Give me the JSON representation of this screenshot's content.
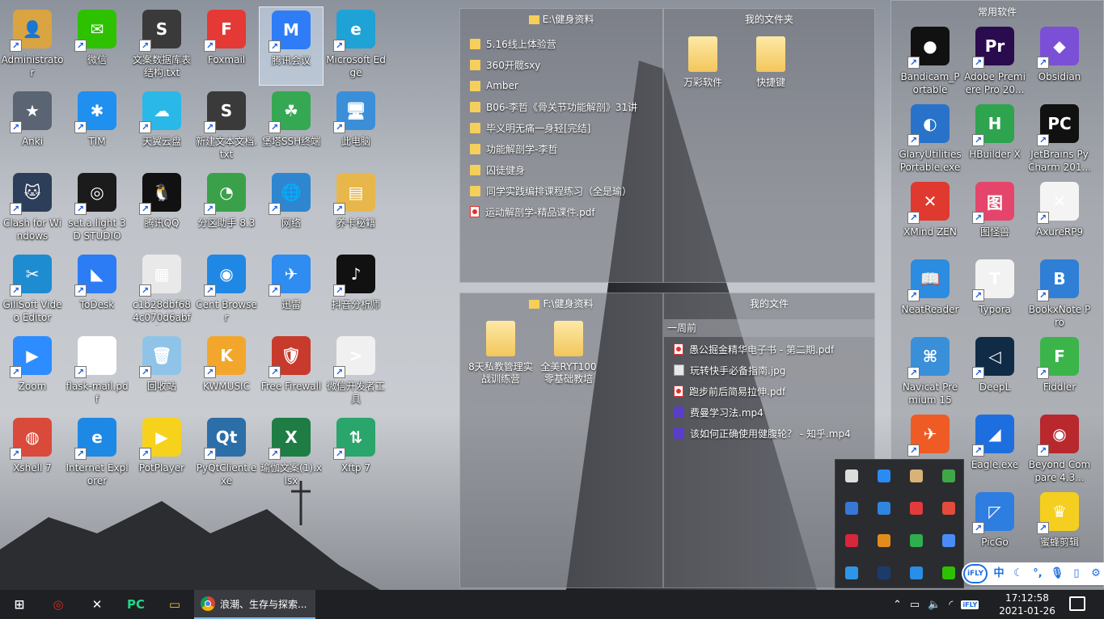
{
  "desktop_icons": [
    {
      "label": "Administrator",
      "icon": "user-folder-icon",
      "color": "#d9a441",
      "glyph": "👤"
    },
    {
      "label": "微信",
      "icon": "wechat-icon",
      "color": "#2dc100",
      "glyph": "✉"
    },
    {
      "label": "文案数据库表结构.txt",
      "icon": "sublime-text-icon",
      "color": "#3a3a3a",
      "glyph": "S"
    },
    {
      "label": "Foxmail",
      "icon": "foxmail-icon",
      "color": "#e53935",
      "glyph": "F"
    },
    {
      "label": "腾讯会议",
      "icon": "tencent-meeting-icon",
      "color": "#2f7df6",
      "glyph": "M"
    },
    {
      "label": "Microsoft Edge",
      "icon": "edge-icon",
      "color": "#1fa2d6",
      "glyph": "e"
    },
    {
      "label": "Anki",
      "icon": "anki-icon",
      "color": "#5b6473",
      "glyph": "★"
    },
    {
      "label": "TIM",
      "icon": "tim-icon",
      "color": "#1f8ff0",
      "glyph": "✱"
    },
    {
      "label": "天翼云盘",
      "icon": "cloud-disk-icon",
      "color": "#29b8e8",
      "glyph": "☁"
    },
    {
      "label": "新建文本文档.txt",
      "icon": "sublime-text-icon",
      "color": "#3a3a3a",
      "glyph": "S"
    },
    {
      "label": "堡塔SSH终端",
      "icon": "baota-ssh-icon",
      "color": "#35a853",
      "glyph": "☘"
    },
    {
      "label": "此电脑",
      "icon": "this-pc-icon",
      "color": "#3b8fd9",
      "glyph": "🖥"
    },
    {
      "label": "Clash for Windows",
      "icon": "clash-icon",
      "color": "#2d3e5a",
      "glyph": "🐱"
    },
    {
      "label": "set.a.light 3D STUDIO",
      "icon": "set-a-light-icon",
      "color": "#1b1b1b",
      "glyph": "◎"
    },
    {
      "label": "腾讯QQ",
      "icon": "qq-icon",
      "color": "#111111",
      "glyph": "🐧"
    },
    {
      "label": "分区助手 8.3",
      "icon": "partition-assistant-icon",
      "color": "#3aa14a",
      "glyph": "◔"
    },
    {
      "label": "网络",
      "icon": "network-icon",
      "color": "#2e86d1",
      "glyph": "🌐"
    },
    {
      "label": "养卡秘籍",
      "icon": "pdf-folder-icon",
      "color": "#e7b74c",
      "glyph": "▤"
    },
    {
      "label": "GiliSoft Video Editor",
      "icon": "video-editor-icon",
      "color": "#1e8cd0",
      "glyph": "✂"
    },
    {
      "label": "ToDesk",
      "icon": "todesk-icon",
      "color": "#2c7cf6",
      "glyph": "◣"
    },
    {
      "label": "c1b28dbf684c070d6abf7...",
      "icon": "image-file-icon",
      "color": "#e9e9e9",
      "glyph": "▦"
    },
    {
      "label": "Cent Browser",
      "icon": "cent-browser-icon",
      "color": "#1f88e5",
      "glyph": "◉"
    },
    {
      "label": "迅雷",
      "icon": "xunlei-icon",
      "color": "#2f8cf0",
      "glyph": "✈"
    },
    {
      "label": "抖音分析师",
      "icon": "douyin-icon",
      "color": "#111111",
      "glyph": "♪"
    },
    {
      "label": "Zoom",
      "icon": "zoom-icon",
      "color": "#2d8cff",
      "glyph": "▶"
    },
    {
      "label": "flask-mail.pdf",
      "icon": "pdf-file-icon",
      "color": "#ffffff",
      "glyph": "▯"
    },
    {
      "label": "回收站",
      "icon": "recycle-bin-icon",
      "color": "#8fc4e8",
      "glyph": "🗑"
    },
    {
      "label": "KWMUSIC",
      "icon": "kuwo-music-icon",
      "color": "#f2a72c",
      "glyph": "K"
    },
    {
      "label": "Free Firewall",
      "icon": "firewall-icon",
      "color": "#c83a2b",
      "glyph": "🛡"
    },
    {
      "label": "微信开发者工具",
      "icon": "wechat-devtools-icon",
      "color": "#f0f0f0",
      "glyph": ">"
    },
    {
      "label": "Xshell 7",
      "icon": "xshell-icon",
      "color": "#d94a3a",
      "glyph": "◍"
    },
    {
      "label": "Internet Explorer",
      "icon": "ie-icon",
      "color": "#1e88e5",
      "glyph": "e"
    },
    {
      "label": "PotPlayer",
      "icon": "potplayer-icon",
      "color": "#f7d21c",
      "glyph": "▶"
    },
    {
      "label": "PyQtClient.exe",
      "icon": "pyqt-icon",
      "color": "#2b6ea8",
      "glyph": "Qt"
    },
    {
      "label": "瑜伽文案(1).xlsx",
      "icon": "excel-file-icon",
      "color": "#1e7d45",
      "glyph": "X"
    },
    {
      "label": "Xftp 7",
      "icon": "xftp-icon",
      "color": "#2aa56b",
      "glyph": "⇅"
    }
  ],
  "fences": {
    "e_drive": {
      "title": "E:\\健身资料",
      "items": [
        {
          "name": "5.16线上体验营",
          "type": "folder"
        },
        {
          "name": "360开髋sxy",
          "type": "folder"
        },
        {
          "name": "Amber",
          "type": "folder"
        },
        {
          "name": "B06-李哲《骨关节功能解剖》31讲",
          "type": "folder"
        },
        {
          "name": "毕义明无痛一身轻[完结]",
          "type": "folder"
        },
        {
          "name": "功能解剖学-李哲",
          "type": "folder"
        },
        {
          "name": "囚徒健身",
          "type": "folder"
        },
        {
          "name": "同学实践编排课程练习（全是瑜）",
          "type": "folder"
        },
        {
          "name": "运动解剖学-精品课件.pdf",
          "type": "pdf"
        }
      ]
    },
    "my_folders": {
      "title": "我的文件夹",
      "items": [
        {
          "name": "万彩软件",
          "type": "folder"
        },
        {
          "name": "快捷键",
          "type": "folder"
        }
      ]
    },
    "f_drive": {
      "title": "F:\\健身资料",
      "items": [
        {
          "name": "8天私教管理实战训练营",
          "type": "folder"
        },
        {
          "name": "全美RYT100零基础教培",
          "type": "folder"
        }
      ]
    },
    "my_files": {
      "title": "我的文件",
      "group": "一周前",
      "items": [
        {
          "name": "愚公掘金精华电子书 - 第二期.pdf",
          "type": "pdf"
        },
        {
          "name": "玩转快手必备指南.jpg",
          "type": "jpg"
        },
        {
          "name": "跑步前后简易拉伸.pdf",
          "type": "pdf"
        },
        {
          "name": "费曼学习法.mp4",
          "type": "mp4"
        },
        {
          "name": "该如何正确使用健腹轮？ - 知乎.mp4",
          "type": "mp4"
        }
      ]
    }
  },
  "common_software": {
    "title": "常用软件",
    "items": [
      {
        "label": "Bandicam_Portable",
        "icon": "bandicam-icon",
        "color": "#111111",
        "glyph": "●"
      },
      {
        "label": "Adobe Premiere Pro 20...",
        "icon": "premiere-icon",
        "color": "#2a0c4e",
        "glyph": "Pr"
      },
      {
        "label": "Obsidian",
        "icon": "obsidian-icon",
        "color": "#7b4fd6",
        "glyph": "◆"
      },
      {
        "label": "GlaryUtilitiesPortable.exe",
        "icon": "glary-icon",
        "color": "#2873c9",
        "glyph": "◐"
      },
      {
        "label": "HBuilder X",
        "icon": "hbuilder-icon",
        "color": "#2ea44f",
        "glyph": "H"
      },
      {
        "label": "JetBrains PyCharm 201...",
        "icon": "pycharm-icon",
        "color": "#111111",
        "glyph": "PC"
      },
      {
        "label": "XMind ZEN",
        "icon": "xmind-icon",
        "color": "#e0392f",
        "glyph": "✕"
      },
      {
        "label": "图怪兽",
        "icon": "tuguaishou-icon",
        "color": "#e6456b",
        "glyph": "图"
      },
      {
        "label": "AxureRP9",
        "icon": "axure-icon",
        "color": "#f4f4f4",
        "glyph": "✕"
      },
      {
        "label": "NeatReader",
        "icon": "neatreader-icon",
        "color": "#2c8ce0",
        "glyph": "📖"
      },
      {
        "label": "Typora",
        "icon": "typora-icon",
        "color": "#f2f2f2",
        "glyph": "T"
      },
      {
        "label": "BookxNote Pro",
        "icon": "bookxnote-icon",
        "color": "#2f7fd6",
        "glyph": "B"
      },
      {
        "label": "Navicat Premium 15",
        "icon": "navicat-icon",
        "color": "#3a8fd9",
        "glyph": "⌘"
      },
      {
        "label": "DeepL",
        "icon": "deepl-icon",
        "color": "#0f2b46",
        "glyph": "◁"
      },
      {
        "label": "Fiddler",
        "icon": "fiddler-icon",
        "color": "#3bb54a",
        "glyph": "F"
      },
      {
        "label": "",
        "icon": "postman-icon",
        "color": "#ef5b25",
        "glyph": "✈"
      },
      {
        "label": "Eagle.exe",
        "icon": "eagle-icon",
        "color": "#1d6fe0",
        "glyph": "◢"
      },
      {
        "label": "Beyond Compare 4.3...",
        "icon": "beyond-compare-icon",
        "color": "#b8282d",
        "glyph": "◉"
      },
      {
        "label": "",
        "icon": "blank-icon",
        "color": "#00000000",
        "glyph": ""
      },
      {
        "label": "PicGo",
        "icon": "picgo-icon",
        "color": "#2e7de0",
        "glyph": "◸"
      },
      {
        "label": "蜜蜂剪辑",
        "icon": "bee-cut-icon",
        "color": "#f5cf1f",
        "glyph": "♛"
      }
    ]
  },
  "tray_overflow": [
    {
      "icon": "usb-icon",
      "color": "#dddddd"
    },
    {
      "icon": "shield-icon",
      "color": "#2a8bf2"
    },
    {
      "icon": "cat-icon",
      "color": "#d9b27a"
    },
    {
      "icon": "green-shield-icon",
      "color": "#3ea846"
    },
    {
      "icon": "display-icon",
      "color": "#3778d6"
    },
    {
      "icon": "pencil-app-icon",
      "color": "#2e86e0"
    },
    {
      "icon": "security-ball-icon",
      "color": "#e33b3b"
    },
    {
      "icon": "chrome-like-icon",
      "color": "#e24c3b"
    },
    {
      "icon": "cherry-icon",
      "color": "#d8263a"
    },
    {
      "icon": "colorful-app-icon",
      "color": "#e28c1c"
    },
    {
      "icon": "swirl-icon",
      "color": "#2fae4f"
    },
    {
      "icon": "baidu-disk-icon",
      "color": "#4a8cf7"
    },
    {
      "icon": "weather-icon",
      "color": "#2e96e8"
    },
    {
      "icon": "terminal-icon",
      "color": "#1b3b6b"
    },
    {
      "icon": "blue-square-icon",
      "color": "#2a8de6"
    },
    {
      "icon": "wechat-tray-icon",
      "color": "#2dc100"
    }
  ],
  "ime": {
    "brand": "iFLY",
    "mode": "中",
    "items": [
      "moon-icon",
      "punctuation-icon",
      "mic-icon",
      "clipboard-icon",
      "gear-icon"
    ]
  },
  "taskbar": {
    "pinned": [
      {
        "icon": "windows-start-icon",
        "color": "#ffffff",
        "glyph": "⊞"
      },
      {
        "icon": "netease-music-icon",
        "color": "#e02424",
        "glyph": "◎"
      },
      {
        "icon": "xmind-taskbar-icon",
        "color": "#ffffff",
        "glyph": "✕"
      },
      {
        "icon": "pycharm-taskbar-icon",
        "color": "#21d789",
        "glyph": "PC"
      },
      {
        "icon": "file-explorer-icon",
        "color": "#f2c341",
        "glyph": "▭"
      }
    ],
    "active_window": {
      "icon": "chrome-icon",
      "title": "浪潮、生存与探索..."
    },
    "clock_time": "17:12:58",
    "clock_date": "2021-01-26",
    "ime_badge": "iFLY"
  }
}
